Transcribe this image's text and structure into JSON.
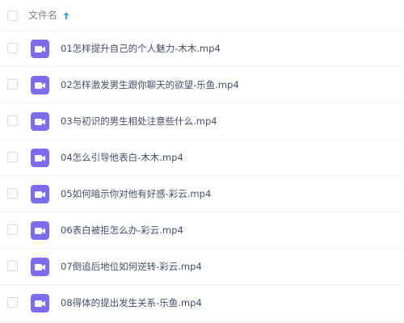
{
  "header": {
    "column_label": "文件名",
    "sort_icon": "arrow-up-icon"
  },
  "colors": {
    "video_icon_bg": "#7c6df0",
    "sort_arrow": "#2ea6e6",
    "text": "#424e67",
    "header_text": "#7e8594"
  },
  "files": [
    {
      "name": "01怎样提升自己的个人魅力-木木.mp4",
      "icon": "video-file-icon"
    },
    {
      "name": "02怎样激发男生跟你聊天的欲望-乐鱼.mp4",
      "icon": "video-file-icon"
    },
    {
      "name": "03与初识的男生相处注意些什么.mp4",
      "icon": "video-file-icon"
    },
    {
      "name": "04怎么引导他表白-木木.mp4",
      "icon": "video-file-icon"
    },
    {
      "name": "05如何暗示你对他有好感-彩云.mp4",
      "icon": "video-file-icon"
    },
    {
      "name": "06表白被拒怎么办-彩云.mp4",
      "icon": "video-file-icon"
    },
    {
      "name": "07倒追后地位如何逆转-彩云.mp4",
      "icon": "video-file-icon"
    },
    {
      "name": "08得体的提出发生关系-乐鱼.mp4",
      "icon": "video-file-icon"
    }
  ]
}
